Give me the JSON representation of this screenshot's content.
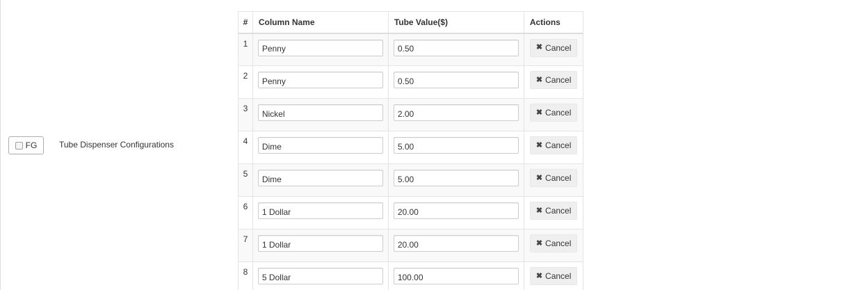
{
  "option": {
    "toggle_label": "FG",
    "label": "Tube Dispenser Configurations"
  },
  "table": {
    "headers": {
      "num": "#",
      "column_name": "Column Name",
      "tube_value": "Tube Value($)",
      "actions": "Actions"
    },
    "cancel_icon_glyph": "✖",
    "cancel_label": "Cancel",
    "rows": [
      {
        "num": "1",
        "name": "Penny",
        "value": "0.50"
      },
      {
        "num": "2",
        "name": "Penny",
        "value": "0.50"
      },
      {
        "num": "3",
        "name": "Nickel",
        "value": "2.00"
      },
      {
        "num": "4",
        "name": "Dime",
        "value": "5.00"
      },
      {
        "num": "5",
        "name": "Dime",
        "value": "5.00"
      },
      {
        "num": "6",
        "name": "1 Dollar",
        "value": "20.00"
      },
      {
        "num": "7",
        "name": "1 Dollar",
        "value": "20.00"
      },
      {
        "num": "8",
        "name": "5 Dollar",
        "value": "100.00"
      }
    ]
  },
  "icons": {
    "cancel": "close-icon",
    "checkbox": "checkbox-icon"
  },
  "colors": {
    "border": "#e4e4e4",
    "stripe": "#f9f9f9",
    "button_bg": "#efefef"
  }
}
